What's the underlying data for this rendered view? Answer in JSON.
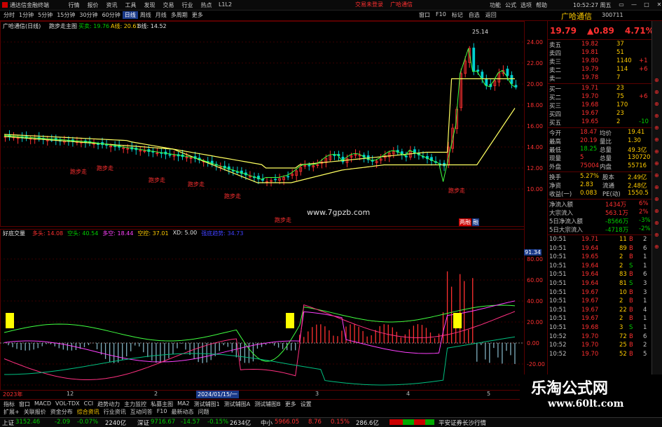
{
  "titlebar": {
    "app_name": "通达信金融终端",
    "menu": [
      "行情",
      "报价",
      "资讯",
      "工具",
      "发现",
      "交易",
      "行业",
      "热点",
      "L1L2"
    ],
    "trade": [
      "交易未登录",
      "广哈通信"
    ],
    "right_menu": [
      "功能",
      "公式",
      "选项",
      "帮助"
    ],
    "clock": "10:52:27 周五",
    "controls": [
      "▭",
      "—",
      "□",
      "✕"
    ]
  },
  "periods": [
    "分时",
    "1分钟",
    "5分钟",
    "15分钟",
    "30分钟",
    "60分钟",
    "日线",
    "周线",
    "月线",
    "多周期",
    "更多"
  ],
  "active_period": "日线",
  "toolbar_right": [
    "窗口",
    "F10",
    "标记",
    "自选",
    "返回"
  ],
  "stock": {
    "name": "广哈通信",
    "code": "300711"
  },
  "main_pane": {
    "title": "广哈通信(日线)",
    "indicator": "跑步走主图",
    "buy_label": "买卖: 19.76",
    "a_label": "A线: 20.61",
    "b_label": "B线: 14.52",
    "peak_label": "25.14",
    "watermark": "www.7gpzb.com",
    "signal_text": "跑步走",
    "bottom_marks": [
      "两融",
      "融"
    ],
    "y_ticks": [
      "24.00",
      "22.00",
      "20.00",
      "18.00",
      "16.00",
      "14.00",
      "12.00",
      "10.00"
    ]
  },
  "sub_pane": {
    "title": "好底交量",
    "labels": [
      {
        "t": "多头: 14.08",
        "c": "#ff3030"
      },
      {
        "t": "空头: 40.54",
        "c": "#00d000"
      },
      {
        "t": "多空: 18.44",
        "c": "#ff40ff"
      },
      {
        "t": "空控: 37.01",
        "c": "#ffcc00"
      },
      {
        "t": "XD: 5.00",
        "c": "#e0e0e0"
      },
      {
        "t": "强底趋势: 34.73",
        "c": "#4040ff"
      }
    ],
    "marker_value": "91.34",
    "y_ticks": [
      "80.00",
      "60.00",
      "40.00",
      "20.00",
      "0.00",
      "-20.00",
      "-40.00"
    ]
  },
  "x_axis": {
    "labels": [
      "2023年",
      "12",
      "2",
      "3",
      "4",
      "5",
      "6"
    ],
    "cursor_date": "2024/01/15/一"
  },
  "quote": {
    "price": "19.79",
    "change": "▲0.89",
    "pct": "4.71%",
    "asks": [
      {
        "lbl": "卖五",
        "p": "19.82",
        "v": "37",
        "d": ""
      },
      {
        "lbl": "卖四",
        "p": "19.81",
        "v": "51",
        "d": ""
      },
      {
        "lbl": "卖三",
        "p": "19.80",
        "v": "1140",
        "d": "+1"
      },
      {
        "lbl": "卖二",
        "p": "19.79",
        "v": "114",
        "d": "+6"
      },
      {
        "lbl": "卖一",
        "p": "19.78",
        "v": "7",
        "d": ""
      }
    ],
    "bids": [
      {
        "lbl": "买一",
        "p": "19.71",
        "v": "23",
        "d": ""
      },
      {
        "lbl": "买二",
        "p": "19.70",
        "v": "75",
        "d": "+6"
      },
      {
        "lbl": "买三",
        "p": "19.68",
        "v": "170",
        "d": ""
      },
      {
        "lbl": "买四",
        "p": "19.67",
        "v": "23",
        "d": ""
      },
      {
        "lbl": "买五",
        "p": "19.65",
        "v": "2",
        "d": "-10"
      }
    ],
    "stats": [
      {
        "a": "今开",
        "av": "18.47",
        "b": "均价",
        "bv": "19.41"
      },
      {
        "a": "最高",
        "av": "20.19",
        "b": "量比",
        "bv": "1.30"
      },
      {
        "a": "最低",
        "av": "18.25",
        "b": "总量",
        "bv": "49.3亿"
      },
      {
        "a": "现量",
        "av": "5",
        "b": "总量",
        "bv": "130720"
      },
      {
        "a": "外盘",
        "av": "75004",
        "b": "内盘",
        "bv": "55716"
      }
    ],
    "stats2": [
      {
        "a": "换手",
        "av": "5.27%",
        "b": "股本",
        "bv": "2.49亿"
      },
      {
        "a": "净资",
        "av": "2.83",
        "b": "流通",
        "bv": "2.48亿"
      },
      {
        "a": "收益(一)",
        "av": "0.083",
        "b": "PE(动)",
        "bv": "1550.5"
      }
    ],
    "flows": [
      {
        "l": "净流入额",
        "v": "1434万",
        "p": "6%",
        "c": "#ff3030"
      },
      {
        "l": "大宗流入",
        "v": "563.1万",
        "p": "2%",
        "c": "#ff3030"
      },
      {
        "l": "5日净流入额",
        "v": "-8566万",
        "p": "-3%",
        "c": "#00d000"
      },
      {
        "l": "5日大宗流入",
        "v": "-4718万",
        "p": "-2%",
        "c": "#00d000"
      }
    ],
    "ticks": [
      {
        "t": "10:51",
        "p": "19.71",
        "v": "11",
        "s": "B",
        "n": "2"
      },
      {
        "t": "10:51",
        "p": "19.64",
        "v": "89",
        "s": "B",
        "n": "6"
      },
      {
        "t": "10:51",
        "p": "19.65",
        "v": "2",
        "s": "B",
        "n": "1"
      },
      {
        "t": "10:51",
        "p": "19.64",
        "v": "2",
        "s": "S",
        "n": "1"
      },
      {
        "t": "10:51",
        "p": "19.64",
        "v": "83",
        "s": "B",
        "n": "6"
      },
      {
        "t": "10:51",
        "p": "19.64",
        "v": "81",
        "s": "S",
        "n": "3"
      },
      {
        "t": "10:51",
        "p": "19.67",
        "v": "10",
        "s": "B",
        "n": "3"
      },
      {
        "t": "10:51",
        "p": "19.67",
        "v": "2",
        "s": "B",
        "n": "1"
      },
      {
        "t": "10:51",
        "p": "19.67",
        "v": "22",
        "s": "B",
        "n": "4"
      },
      {
        "t": "10:51",
        "p": "19.67",
        "v": "2",
        "s": "B",
        "n": "1"
      },
      {
        "t": "10:51",
        "p": "19.68",
        "v": "3",
        "s": "S",
        "n": "1"
      },
      {
        "t": "10:52",
        "p": "19.70",
        "v": "72",
        "s": "B",
        "n": "6"
      },
      {
        "t": "10:52",
        "p": "19.70",
        "v": "25",
        "s": "B",
        "n": "2"
      },
      {
        "t": "10:52",
        "p": "19.70",
        "v": "52",
        "s": "B",
        "n": "5"
      }
    ]
  },
  "bottom_tabs": [
    "指标",
    "窗口",
    "MACD",
    "VOL-TDX",
    "CCI",
    "趋势动力",
    "主力监控",
    "私募主图",
    "MA2",
    "测试辅图1",
    "测试辅图A",
    "测试辅图B",
    "更多",
    "设置"
  ],
  "bottom_tabs2": [
    "扩展+",
    "关联报价",
    "资金分布",
    "综合资讯",
    "行业资讯",
    "互动问答",
    "F10",
    "最新动态",
    "问题"
  ],
  "status": {
    "sh_label": "上证",
    "sh_val": "3152.46",
    "sh_chg": "-2.09",
    "sh_pct": "-0.07%",
    "sh_amt": "2240亿",
    "sz_label": "深证",
    "sz_val": "9716.67",
    "sz_chg": "-14.57",
    "sz_pct": "-0.15%",
    "sz_amt": "2634亿",
    "zx_label": "中小",
    "zx_val": "5966.05",
    "zx_chg": "8.76",
    "zx_pct": "0.15%",
    "zx_amt": "286.6亿",
    "broker": "平安证券长沙行情"
  },
  "watermark": {
    "line1": "乐淘公式网",
    "line2": "www.60lt.com"
  },
  "scroll_marks": [
    "⊕",
    "⊕",
    "⊕",
    "⊕",
    "⊕",
    "⊕",
    "⊕",
    "⊕",
    "⊕",
    "⊕",
    "⊕",
    "⊕",
    "⊕",
    "⊕",
    "⊕"
  ],
  "colors": {
    "up": "#ff3030",
    "down": "#00d000",
    "accent": "#ffcc00",
    "frame": "#5a0000"
  }
}
